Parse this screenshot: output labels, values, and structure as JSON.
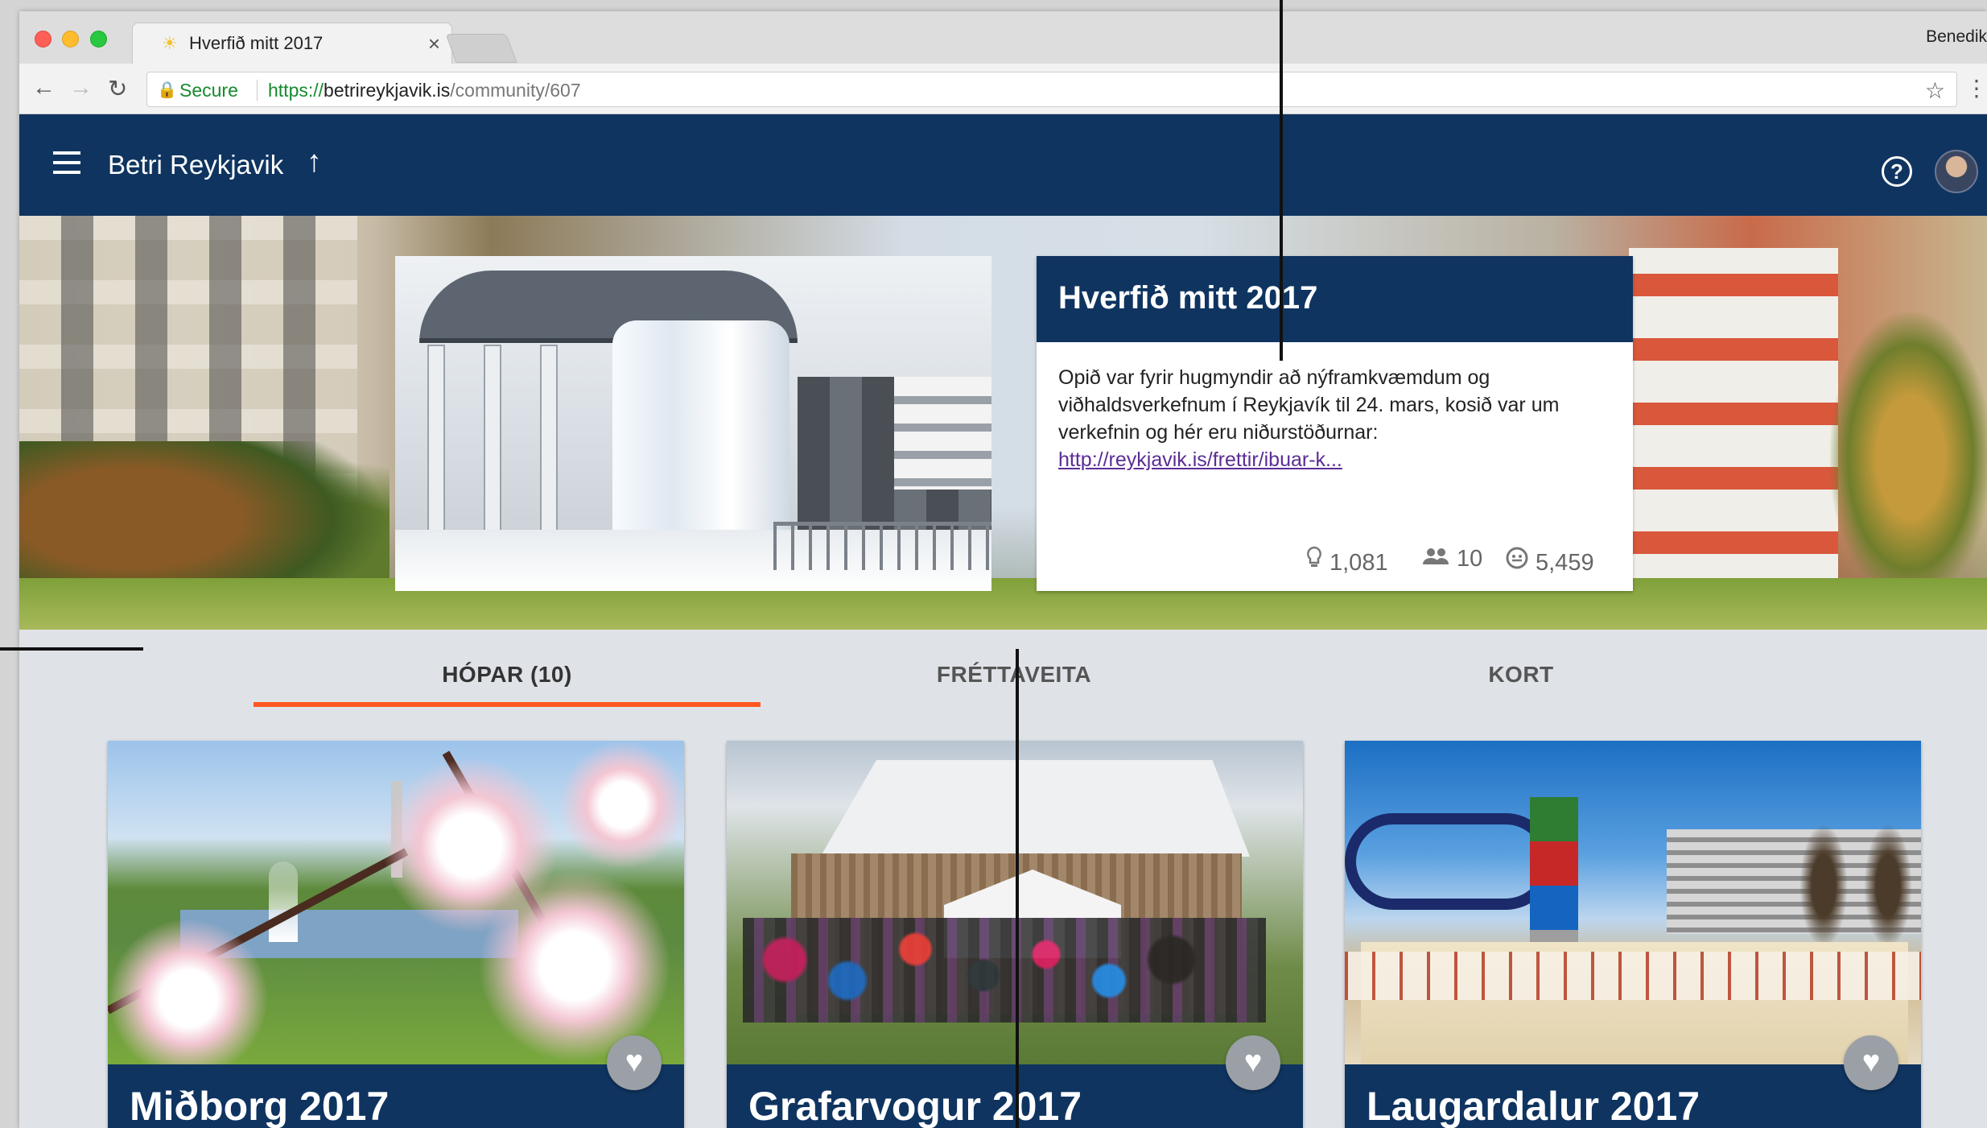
{
  "browser": {
    "tab_title": "Hverfið mitt 2017",
    "tab_close": "×",
    "profile_name": "Benedik",
    "secure_label": "Secure",
    "url_scheme": "https://",
    "url_host": "betrireykjavik.is",
    "url_path": "/community/607",
    "back": "←",
    "forward": "→",
    "reload": "↻",
    "star": "☆",
    "menu": "⋮"
  },
  "header": {
    "app_title": "Betri Reykjavik",
    "up_arrow": "↑",
    "help": "?"
  },
  "community": {
    "title": "Hverfið mitt 2017",
    "description": "Opið var fyrir hugmyndir að nýframkvæmdum og viðhaldsverkefnum í Reykjavík til 24. mars, kosið var um verkefnin og hér eru niðurstöðurnar:",
    "link": "http://reykjavik.is/frettir/ibuar-k...",
    "stats": {
      "ideas": "1,081",
      "users": "10",
      "views": "5,459"
    }
  },
  "tabs": [
    {
      "label": "HÓPAR  (10)",
      "active": true
    },
    {
      "label": "FRÉTTAVEITA",
      "active": false
    },
    {
      "label": "KORT",
      "active": false
    }
  ],
  "groups": [
    {
      "title": "Miðborg 2017"
    },
    {
      "title": "Grafarvogur 2017"
    },
    {
      "title": "Laugardalur 2017"
    }
  ],
  "icons": {
    "heart": "♥",
    "lightbulb": "💡",
    "people": "👥",
    "face": "☺",
    "lock": "🔒",
    "sun": "☀"
  },
  "colors": {
    "primary": "#0f3460",
    "accent": "#ff5722",
    "link": "#5a2d96",
    "secure": "#158a2e"
  }
}
